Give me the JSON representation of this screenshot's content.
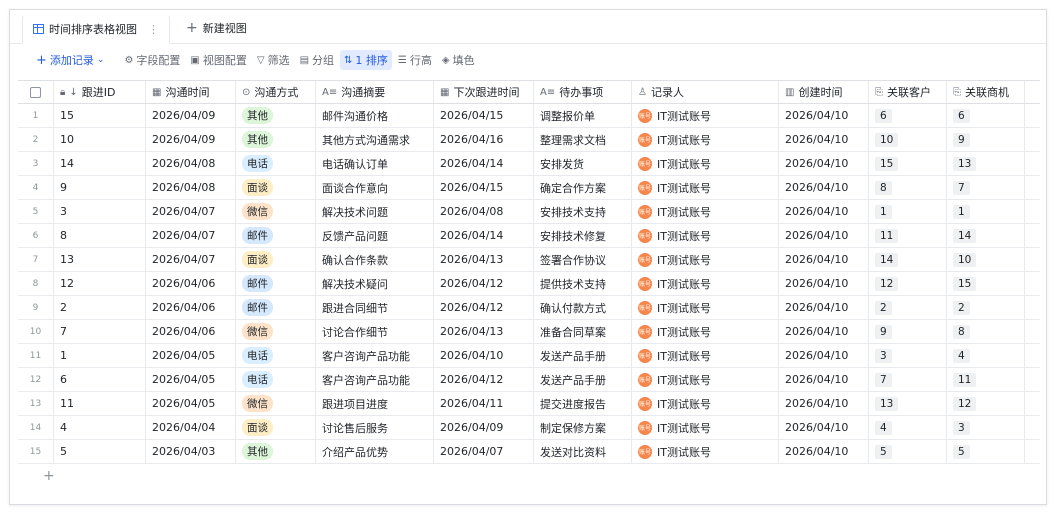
{
  "tabs": [
    {
      "label": "时间排序表格视图",
      "active": true
    },
    {
      "label": "新建视图",
      "active": false
    }
  ],
  "toolbar": {
    "add_record": "添加记录",
    "field_config": "字段配置",
    "view_config": "视图配置",
    "filter": "筛选",
    "group": "分组",
    "sort": "1 排序",
    "row_height": "行高",
    "fill_color": "填色"
  },
  "columns": [
    "跟进ID",
    "沟通时间",
    "沟通方式",
    "沟通摘要",
    "下次跟进时间",
    "待办事项",
    "记录人",
    "创建时间",
    "关联客户",
    "关联商机"
  ],
  "tag_colors": {
    "其他": "#ddf5d8",
    "电话": "#d9eefe",
    "面谈": "#fdeec6",
    "微信": "#fde3c9",
    "邮件": "#d5e8fc"
  },
  "rows": [
    {
      "n": "1",
      "id": "15",
      "time": "2026/04/09",
      "method": "其他",
      "summary": "邮件沟通价格",
      "next": "2026/04/15",
      "todo": "调整报价单",
      "recorder": "IT测试账号",
      "created": "2026/04/10",
      "customer": "6",
      "opp": "6"
    },
    {
      "n": "2",
      "id": "10",
      "time": "2026/04/09",
      "method": "其他",
      "summary": "其他方式沟通需求",
      "next": "2026/04/16",
      "todo": "整理需求文档",
      "recorder": "IT测试账号",
      "created": "2026/04/10",
      "customer": "10",
      "opp": "9"
    },
    {
      "n": "3",
      "id": "14",
      "time": "2026/04/08",
      "method": "电话",
      "summary": "电话确认订单",
      "next": "2026/04/14",
      "todo": "安排发货",
      "recorder": "IT测试账号",
      "created": "2026/04/10",
      "customer": "15",
      "opp": "13"
    },
    {
      "n": "4",
      "id": "9",
      "time": "2026/04/08",
      "method": "面谈",
      "summary": "面谈合作意向",
      "next": "2026/04/15",
      "todo": "确定合作方案",
      "recorder": "IT测试账号",
      "created": "2026/04/10",
      "customer": "8",
      "opp": "7"
    },
    {
      "n": "5",
      "id": "3",
      "time": "2026/04/07",
      "method": "微信",
      "summary": "解决技术问题",
      "next": "2026/04/08",
      "todo": "安排技术支持",
      "recorder": "IT测试账号",
      "created": "2026/04/10",
      "customer": "1",
      "opp": "1"
    },
    {
      "n": "6",
      "id": "8",
      "time": "2026/04/07",
      "method": "邮件",
      "summary": "反馈产品问题",
      "next": "2026/04/14",
      "todo": "安排技术修复",
      "recorder": "IT测试账号",
      "created": "2026/04/10",
      "customer": "11",
      "opp": "14"
    },
    {
      "n": "7",
      "id": "13",
      "time": "2026/04/07",
      "method": "面谈",
      "summary": "确认合作条款",
      "next": "2026/04/13",
      "todo": "签署合作协议",
      "recorder": "IT测试账号",
      "created": "2026/04/10",
      "customer": "14",
      "opp": "10"
    },
    {
      "n": "8",
      "id": "12",
      "time": "2026/04/06",
      "method": "邮件",
      "summary": "解决技术疑问",
      "next": "2026/04/12",
      "todo": "提供技术支持",
      "recorder": "IT测试账号",
      "created": "2026/04/10",
      "customer": "12",
      "opp": "15"
    },
    {
      "n": "9",
      "id": "2",
      "time": "2026/04/06",
      "method": "邮件",
      "summary": "跟进合同细节",
      "next": "2026/04/12",
      "todo": "确认付款方式",
      "recorder": "IT测试账号",
      "created": "2026/04/10",
      "customer": "2",
      "opp": "2"
    },
    {
      "n": "10",
      "id": "7",
      "time": "2026/04/06",
      "method": "微信",
      "summary": "讨论合作细节",
      "next": "2026/04/13",
      "todo": "准备合同草案",
      "recorder": "IT测试账号",
      "created": "2026/04/10",
      "customer": "9",
      "opp": "8"
    },
    {
      "n": "11",
      "id": "1",
      "time": "2026/04/05",
      "method": "电话",
      "summary": "客户咨询产品功能",
      "next": "2026/04/10",
      "todo": "发送产品手册",
      "recorder": "IT测试账号",
      "created": "2026/04/10",
      "customer": "3",
      "opp": "4"
    },
    {
      "n": "12",
      "id": "6",
      "time": "2026/04/05",
      "method": "电话",
      "summary": "客户咨询产品功能",
      "next": "2026/04/12",
      "todo": "发送产品手册",
      "recorder": "IT测试账号",
      "created": "2026/04/10",
      "customer": "7",
      "opp": "11"
    },
    {
      "n": "13",
      "id": "11",
      "time": "2026/04/05",
      "method": "微信",
      "summary": "跟进项目进度",
      "next": "2026/04/11",
      "todo": "提交进度报告",
      "recorder": "IT测试账号",
      "created": "2026/04/10",
      "customer": "13",
      "opp": "12"
    },
    {
      "n": "14",
      "id": "4",
      "time": "2026/04/04",
      "method": "面谈",
      "summary": "讨论售后服务",
      "next": "2026/04/09",
      "todo": "制定保修方案",
      "recorder": "IT测试账号",
      "created": "2026/04/10",
      "customer": "4",
      "opp": "3"
    },
    {
      "n": "15",
      "id": "5",
      "time": "2026/04/03",
      "method": "其他",
      "summary": "介绍产品优势",
      "next": "2026/04/07",
      "todo": "发送对比资料",
      "recorder": "IT测试账号",
      "created": "2026/04/10",
      "customer": "5",
      "opp": "5"
    }
  ],
  "avatar_text": "账号",
  "add_row_glyph": "+"
}
